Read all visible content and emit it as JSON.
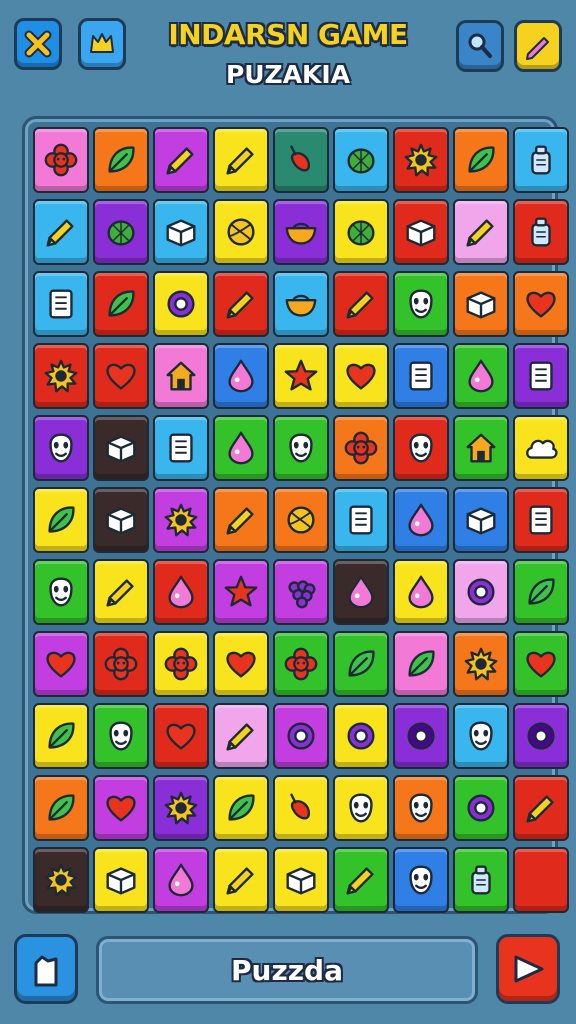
{
  "header": {
    "title": "INDARSN GAME",
    "subtitle": "PUZAKIA"
  },
  "buttons": {
    "close": {
      "icon": "close-x-icon",
      "color": "#1f8fe6"
    },
    "item": {
      "icon": "crown-icon",
      "color": "#3aa6f0"
    },
    "search": {
      "icon": "search-icon",
      "color": "#3a85c8"
    },
    "edit": {
      "icon": "pencil-icon",
      "color": "#f6d21e"
    },
    "home": {
      "icon": "home-icon",
      "color": "#2a92e0"
    },
    "play": {
      "icon": "play-icon",
      "color": "#e8341f"
    }
  },
  "status": {
    "label": "Puzzda"
  },
  "palette": {
    "pink": "#f27ad6",
    "orange": "#f6761a",
    "magenta": "#c23ee0",
    "yellow": "#f8e31d",
    "teal": "#2a8a70",
    "sky": "#3ab6ee",
    "red": "#e02a1c",
    "green": "#34c22a",
    "purple": "#8a2ed8",
    "blue": "#2f7fe6",
    "dark": "#3a2a2a",
    "lightpink": "#f1a6ec"
  },
  "board": {
    "rows": [
      [
        {
          "c": "pink",
          "i": "flower"
        },
        {
          "c": "orange",
          "i": "leaf"
        },
        {
          "c": "magenta",
          "i": "pencil"
        },
        {
          "c": "yellow",
          "i": "pencil"
        },
        {
          "c": "teal",
          "i": "pepper"
        },
        {
          "c": "sky",
          "i": "melon"
        },
        {
          "c": "red",
          "i": "sun"
        },
        {
          "c": "orange",
          "i": "leaf"
        },
        {
          "c": "sky",
          "i": "bottle"
        }
      ],
      [
        {
          "c": "sky",
          "i": "pencil"
        },
        {
          "c": "purple",
          "i": "melon"
        },
        {
          "c": "sky",
          "i": "box"
        },
        {
          "c": "yellow",
          "i": "ball"
        },
        {
          "c": "purple",
          "i": "bowl"
        },
        {
          "c": "yellow",
          "i": "melon"
        },
        {
          "c": "red",
          "i": "box"
        },
        {
          "c": "lightpink",
          "i": "pencil"
        },
        {
          "c": "red",
          "i": "bottle"
        }
      ],
      [
        {
          "c": "sky",
          "i": "book"
        },
        {
          "c": "red",
          "i": "leaf"
        },
        {
          "c": "yellow",
          "i": "ring"
        },
        {
          "c": "red",
          "i": "pencil"
        },
        {
          "c": "sky",
          "i": "bowl"
        },
        {
          "c": "red",
          "i": "pencil"
        },
        {
          "c": "green",
          "i": "face"
        },
        {
          "c": "orange",
          "i": "box"
        },
        {
          "c": "orange",
          "i": "heart"
        }
      ],
      [
        {
          "c": "red",
          "i": "sun"
        },
        {
          "c": "red",
          "i": "heart"
        },
        {
          "c": "pink",
          "i": "house"
        },
        {
          "c": "blue",
          "i": "drop"
        },
        {
          "c": "yellow",
          "i": "star"
        },
        {
          "c": "yellow",
          "i": "heart"
        },
        {
          "c": "blue",
          "i": "book"
        },
        {
          "c": "green",
          "i": "drop"
        },
        {
          "c": "purple",
          "i": "book"
        }
      ],
      [
        {
          "c": "purple",
          "i": "face"
        },
        {
          "c": "dark",
          "i": "box"
        },
        {
          "c": "sky",
          "i": "book"
        },
        {
          "c": "green",
          "i": "drop"
        },
        {
          "c": "green",
          "i": "face"
        },
        {
          "c": "orange",
          "i": "flower"
        },
        {
          "c": "red",
          "i": "face"
        },
        {
          "c": "green",
          "i": "house"
        },
        {
          "c": "yellow",
          "i": "cloud"
        }
      ],
      [
        {
          "c": "yellow",
          "i": "leaf"
        },
        {
          "c": "dark",
          "i": "box"
        },
        {
          "c": "magenta",
          "i": "sun"
        },
        {
          "c": "orange",
          "i": "pencil"
        },
        {
          "c": "orange",
          "i": "ball"
        },
        {
          "c": "sky",
          "i": "book"
        },
        {
          "c": "blue",
          "i": "drop"
        },
        {
          "c": "blue",
          "i": "box"
        },
        {
          "c": "red",
          "i": "book"
        }
      ],
      [
        {
          "c": "green",
          "i": "face"
        },
        {
          "c": "yellow",
          "i": "pencil"
        },
        {
          "c": "red",
          "i": "drop"
        },
        {
          "c": "magenta",
          "i": "star"
        },
        {
          "c": "magenta",
          "i": "grapes"
        },
        {
          "c": "dark",
          "i": "drop"
        },
        {
          "c": "yellow",
          "i": "drop"
        },
        {
          "c": "lightpink",
          "i": "ring"
        },
        {
          "c": "green",
          "i": "leaf"
        }
      ],
      [
        {
          "c": "magenta",
          "i": "heart"
        },
        {
          "c": "red",
          "i": "flower"
        },
        {
          "c": "yellow",
          "i": "flower"
        },
        {
          "c": "yellow",
          "i": "heart"
        },
        {
          "c": "green",
          "i": "flower"
        },
        {
          "c": "green",
          "i": "leaf"
        },
        {
          "c": "pink",
          "i": "leaf"
        },
        {
          "c": "orange",
          "i": "sun"
        },
        {
          "c": "green",
          "i": "heart"
        }
      ],
      [
        {
          "c": "yellow",
          "i": "leaf"
        },
        {
          "c": "green",
          "i": "face"
        },
        {
          "c": "red",
          "i": "heart"
        },
        {
          "c": "lightpink",
          "i": "pencil"
        },
        {
          "c": "magenta",
          "i": "ring"
        },
        {
          "c": "yellow",
          "i": "ring"
        },
        {
          "c": "purple",
          "i": "ring"
        },
        {
          "c": "sky",
          "i": "face"
        },
        {
          "c": "purple",
          "i": "ring"
        }
      ],
      [
        {
          "c": "orange",
          "i": "leaf"
        },
        {
          "c": "magenta",
          "i": "heart"
        },
        {
          "c": "purple",
          "i": "sun"
        },
        {
          "c": "yellow",
          "i": "leaf"
        },
        {
          "c": "yellow",
          "i": "pepper"
        },
        {
          "c": "yellow",
          "i": "face"
        },
        {
          "c": "orange",
          "i": "face"
        },
        {
          "c": "green",
          "i": "ring"
        },
        {
          "c": "red",
          "i": "pencil"
        }
      ],
      [
        {
          "c": "dark",
          "i": "sun"
        },
        {
          "c": "yellow",
          "i": "box"
        },
        {
          "c": "magenta",
          "i": "drop"
        },
        {
          "c": "yellow",
          "i": "pencil"
        },
        {
          "c": "yellow",
          "i": "box"
        },
        {
          "c": "green",
          "i": "pencil"
        },
        {
          "c": "blue",
          "i": "face"
        },
        {
          "c": "green",
          "i": "bottle"
        },
        {
          "c": "red",
          "i": "none"
        }
      ]
    ]
  }
}
